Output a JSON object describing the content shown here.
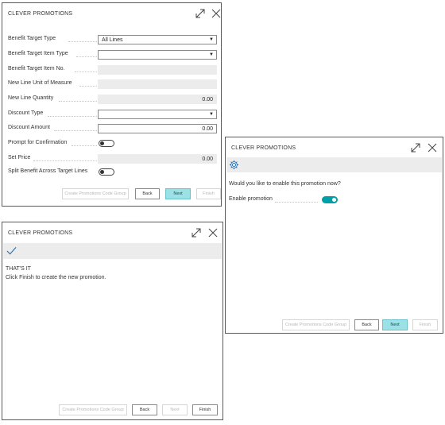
{
  "panel1": {
    "title": "CLEVER PROMOTIONS",
    "fields": [
      {
        "label": "Benefit Target Type",
        "value": "All Lines"
      },
      {
        "label": "Benefit Target Item Type",
        "value": ""
      },
      {
        "label": "Benefit Target Item No.",
        "value": ""
      },
      {
        "label": "New Line Unit of Measure",
        "value": ""
      },
      {
        "label": "New Line Quantity",
        "value": "0.00"
      },
      {
        "label": "Discount Type",
        "value": ""
      },
      {
        "label": "Discount Amount",
        "value": "0.00"
      },
      {
        "label": "Prompt for Confirmation",
        "value": "off"
      },
      {
        "label": "Set Price",
        "value": "0.00"
      },
      {
        "label": "Split Benefit Across Target Lines",
        "value": "off"
      }
    ],
    "buttons": {
      "codegroup": "Create Promotions Code Group",
      "back": "Back",
      "next": "Next",
      "finish": "Finish"
    }
  },
  "panel2": {
    "title": "CLEVER PROMOTIONS",
    "question": "Would you like to enable this promotion now?",
    "enable_label": "Enable promotion",
    "enable_state": "on",
    "buttons": {
      "codegroup": "Create Promotions Code Group",
      "back": "Back",
      "next": "Next",
      "finish": "Finish"
    }
  },
  "panel3": {
    "title": "CLEVER PROMOTIONS",
    "heading": "THAT'S IT",
    "message": "Click Finish to create the new promotion.",
    "buttons": {
      "codegroup": "Create Promotions Code Group",
      "back": "Back",
      "next": "Next",
      "finish": "Finish"
    }
  },
  "icons": {
    "expand": "expand-icon",
    "close": "close-icon",
    "gear": "gear-icon",
    "check": "checkmark-icon"
  },
  "colors": {
    "accent": "#00a0a8",
    "primary_button": "#9ce1e6",
    "band": "#ececec"
  }
}
